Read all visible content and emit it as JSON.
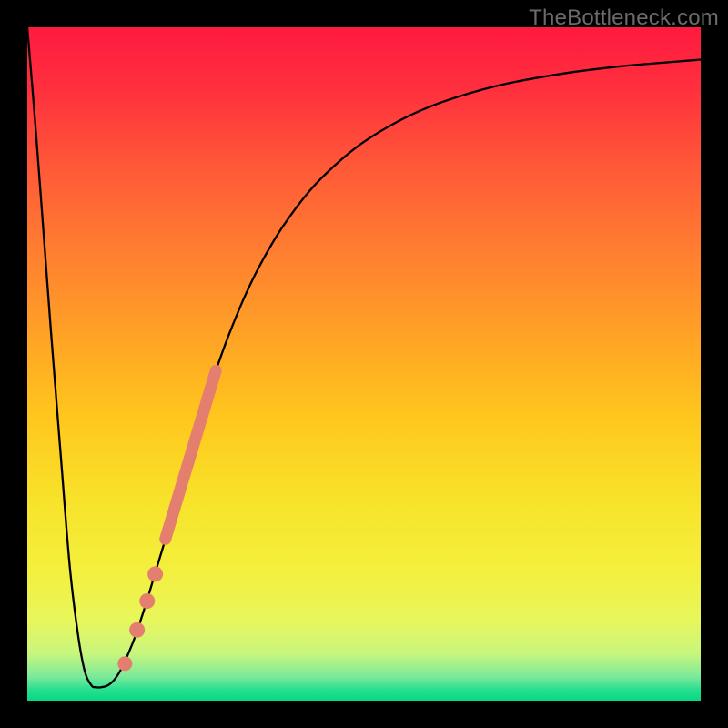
{
  "watermark": "TheBottleneck.com",
  "chart_data": {
    "type": "line",
    "title": "",
    "xlabel": "",
    "ylabel": "",
    "xlim": [
      0,
      100
    ],
    "ylim": [
      0,
      100
    ],
    "grid": false,
    "background_gradient": {
      "stops": [
        {
          "offset": 0.0,
          "color": "#ff1a3f"
        },
        {
          "offset": 0.09,
          "color": "#ff2f3e"
        },
        {
          "offset": 0.2,
          "color": "#ff5638"
        },
        {
          "offset": 0.32,
          "color": "#ff7a31"
        },
        {
          "offset": 0.45,
          "color": "#ffa026"
        },
        {
          "offset": 0.58,
          "color": "#ffc71d"
        },
        {
          "offset": 0.7,
          "color": "#f8e22a"
        },
        {
          "offset": 0.8,
          "color": "#f4ef3b"
        },
        {
          "offset": 0.88,
          "color": "#e8f65c"
        },
        {
          "offset": 0.93,
          "color": "#c8f67d"
        },
        {
          "offset": 0.965,
          "color": "#7ae99a"
        },
        {
          "offset": 0.985,
          "color": "#22df8f"
        },
        {
          "offset": 1.0,
          "color": "#08d884"
        }
      ]
    },
    "series": [
      {
        "name": "bottleneck-curve",
        "color": "#000000",
        "stroke_width": 2.3,
        "x": [
          0.0,
          1.0,
          2.0,
          3.5,
          5.0,
          6.3,
          7.5,
          8.5,
          9.5,
          10.2,
          11.0,
          12.0,
          13.0,
          14.0,
          15.0,
          16.0,
          17.5,
          19.0,
          20.5,
          22.0,
          24.0,
          26.0,
          28.0,
          30.0,
          32.5,
          35.0,
          38.0,
          42.0,
          46.0,
          50.0,
          55.0,
          60.0,
          66.0,
          72.0,
          80.0,
          88.0,
          95.0,
          100.0
        ],
        "y": [
          100.0,
          88.0,
          75.0,
          55.0,
          36.0,
          20.0,
          10.0,
          4.5,
          2.3,
          2.0,
          2.0,
          2.3,
          3.2,
          4.8,
          7.0,
          9.5,
          14.0,
          19.0,
          24.0,
          29.5,
          36.5,
          43.0,
          49.0,
          54.5,
          60.5,
          65.5,
          70.5,
          75.8,
          79.8,
          83.0,
          86.0,
          88.3,
          90.3,
          91.8,
          93.2,
          94.2,
          94.8,
          95.2
        ]
      }
    ],
    "highlight_segment": {
      "name": "highlight-segment",
      "color": "#e47e6e",
      "stroke_width": 13,
      "x": [
        20.5,
        28.0
      ],
      "y": [
        24.0,
        49.0
      ]
    },
    "markers": [
      {
        "name": "dot-1",
        "x": 14.5,
        "y": 5.5,
        "r": 8.0,
        "color": "#e47e6e"
      },
      {
        "name": "dot-2",
        "x": 16.3,
        "y": 10.5,
        "r": 8.5,
        "color": "#e47e6e"
      },
      {
        "name": "dot-3",
        "x": 17.8,
        "y": 14.8,
        "r": 8.5,
        "color": "#e47e6e"
      },
      {
        "name": "dot-4",
        "x": 19.0,
        "y": 18.8,
        "r": 8.5,
        "color": "#e47e6e"
      }
    ]
  }
}
